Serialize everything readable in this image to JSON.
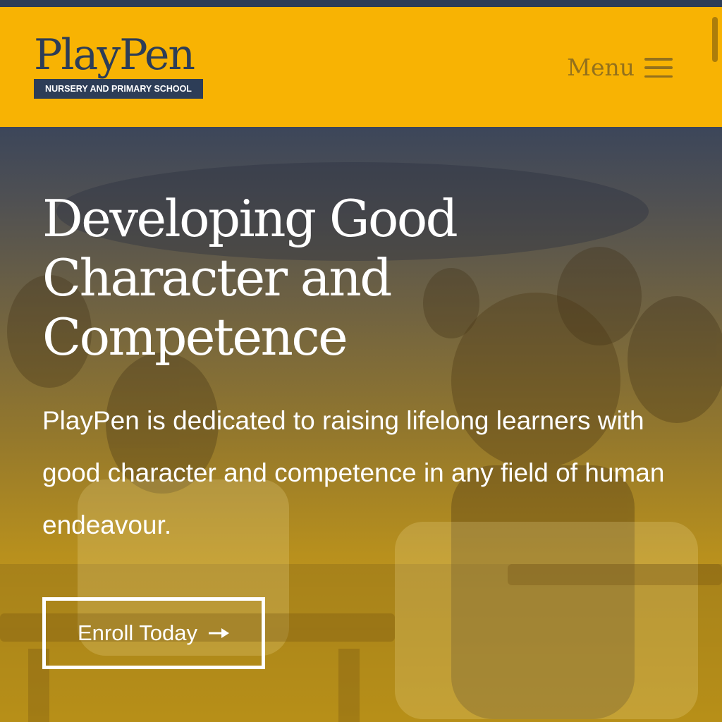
{
  "header": {
    "logo": {
      "name": "PlayPen",
      "tagline": "NURSERY AND PRIMARY SCHOOL"
    },
    "menu_label": "Menu",
    "menu_icon": "hamburger-icon"
  },
  "hero": {
    "title": "Developing Good Character and Competence",
    "text": "PlayPen is dedicated to raising lifelong learners with good character and competence in any field of human endeavour.",
    "cta": {
      "label": "Enroll Today",
      "icon": "arrow-right-icon"
    }
  },
  "colors": {
    "brand_yellow": "#f8b303",
    "brand_navy": "#2d3d57",
    "menu_text": "#94711c",
    "hero_text": "#ffffff"
  }
}
